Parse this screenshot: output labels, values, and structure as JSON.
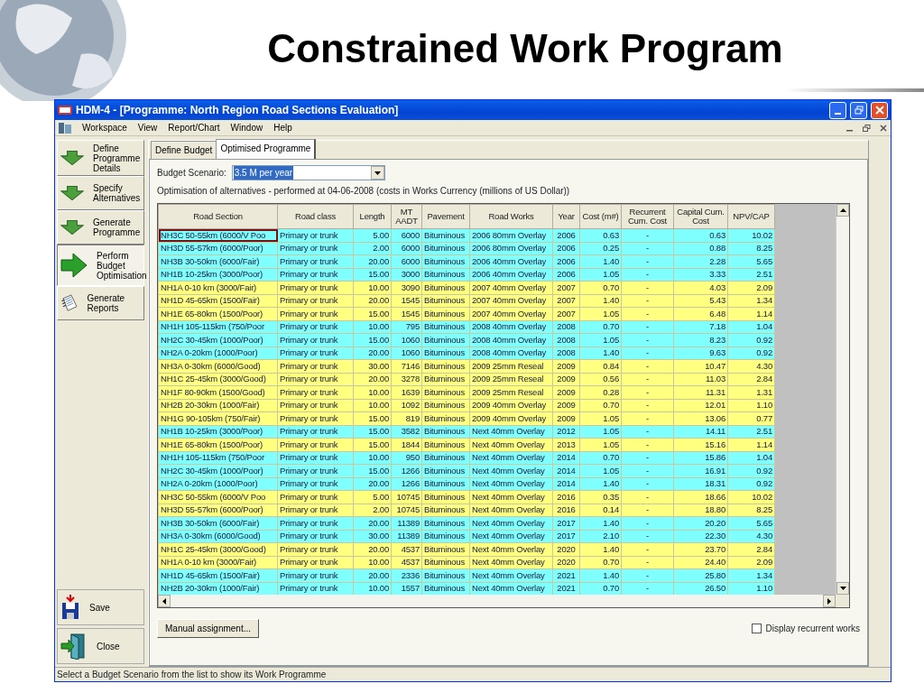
{
  "slide": {
    "title": "Constrained Work Program"
  },
  "window": {
    "title": "HDM-4 - [Programme: North Region Road Sections Evaluation]"
  },
  "menu": [
    "Workspace",
    "View",
    "Report/Chart",
    "Window",
    "Help"
  ],
  "steps": [
    {
      "label": "Define Programme Details",
      "kind": "down",
      "selected": false
    },
    {
      "label": "Specify Alternatives",
      "kind": "down",
      "selected": false
    },
    {
      "label": "Generate Programme",
      "kind": "down",
      "selected": false
    },
    {
      "label": "Perform Budget Optimisation",
      "kind": "right",
      "selected": true
    },
    {
      "label": "Generate Reports",
      "kind": "report",
      "selected": false
    }
  ],
  "actions": [
    {
      "label": "Save",
      "kind": "save"
    },
    {
      "label": "Close",
      "kind": "close"
    }
  ],
  "tabs": [
    {
      "label": "Define Budget",
      "selected": false
    },
    {
      "label": "Optimised Programme",
      "selected": true
    }
  ],
  "budget_scenario": {
    "label": "Budget Scenario:",
    "value": "3.5 M per year"
  },
  "caption": "Optimisation of alternatives - performed at 04-06-2008 (costs in Works Currency (millions of US Dollar))",
  "table": {
    "columns": [
      "Road Section",
      "Road class",
      "Length",
      "MT AADT",
      "Pavement",
      "Road Works",
      "Year",
      "Cost (m#)",
      "Recurrent Cum. Cost",
      "Capital Cum. Cost",
      "NPV/CAP"
    ],
    "rows": [
      {
        "cells": [
          "NH3C 50-55km (6000/V Poo",
          "Primary or trunk",
          "5.00",
          "6000",
          "Bituminous",
          "2006 80mm Overlay",
          "2006",
          "0.63",
          "-",
          "0.63",
          "10.02"
        ],
        "color": "#80ffff",
        "focused": true
      },
      {
        "cells": [
          "NH3D 55-57km (6000/Poor)",
          "Primary or trunk",
          "2.00",
          "6000",
          "Bituminous",
          "2006 80mm Overlay",
          "2006",
          "0.25",
          "-",
          "0.88",
          "8.25"
        ],
        "color": "#80ffff",
        "focused": false
      },
      {
        "cells": [
          "NH3B 30-50km (6000/Fair)",
          "Primary or trunk",
          "20.00",
          "6000",
          "Bituminous",
          "2006 40mm Overlay",
          "2006",
          "1.40",
          "-",
          "2.28",
          "5.65"
        ],
        "color": "#80ffff",
        "focused": false
      },
      {
        "cells": [
          "NH1B 10-25km (3000/Poor)",
          "Primary or trunk",
          "15.00",
          "3000",
          "Bituminous",
          "2006 40mm Overlay",
          "2006",
          "1.05",
          "-",
          "3.33",
          "2.51"
        ],
        "color": "#80ffff",
        "focused": false
      },
      {
        "cells": [
          "NH1A 0-10 km (3000/Fair)",
          "Primary or trunk",
          "10.00",
          "3090",
          "Bituminous",
          "2007 40mm Overlay",
          "2007",
          "0.70",
          "-",
          "4.03",
          "2.09"
        ],
        "color": "#ffff80",
        "focused": false
      },
      {
        "cells": [
          "NH1D 45-65km (1500/Fair)",
          "Primary or trunk",
          "20.00",
          "1545",
          "Bituminous",
          "2007 40mm Overlay",
          "2007",
          "1.40",
          "-",
          "5.43",
          "1.34"
        ],
        "color": "#ffff80",
        "focused": false
      },
      {
        "cells": [
          "NH1E 65-80km (1500/Poor)",
          "Primary or trunk",
          "15.00",
          "1545",
          "Bituminous",
          "2007 40mm Overlay",
          "2007",
          "1.05",
          "-",
          "6.48",
          "1.14"
        ],
        "color": "#ffff80",
        "focused": false
      },
      {
        "cells": [
          "NH1H 105-115km (750/Poor",
          "Primary or trunk",
          "10.00",
          "795",
          "Bituminous",
          "2008 40mm Overlay",
          "2008",
          "0.70",
          "-",
          "7.18",
          "1.04"
        ],
        "color": "#80ffff",
        "focused": false
      },
      {
        "cells": [
          "NH2C 30-45km (1000/Poor)",
          "Primary or trunk",
          "15.00",
          "1060",
          "Bituminous",
          "2008 40mm Overlay",
          "2008",
          "1.05",
          "-",
          "8.23",
          "0.92"
        ],
        "color": "#80ffff",
        "focused": false
      },
      {
        "cells": [
          "NH2A 0-20km (1000/Poor)",
          "Primary or trunk",
          "20.00",
          "1060",
          "Bituminous",
          "2008 40mm Overlay",
          "2008",
          "1.40",
          "-",
          "9.63",
          "0.92"
        ],
        "color": "#80ffff",
        "focused": false
      },
      {
        "cells": [
          "NH3A 0-30km (6000/Good)",
          "Primary or trunk",
          "30.00",
          "7146",
          "Bituminous",
          "2009 25mm Reseal",
          "2009",
          "0.84",
          "-",
          "10.47",
          "4.30"
        ],
        "color": "#ffff80",
        "focused": false
      },
      {
        "cells": [
          "NH1C 25-45km (3000/Good)",
          "Primary or trunk",
          "20.00",
          "3278",
          "Bituminous",
          "2009 25mm Reseal",
          "2009",
          "0.56",
          "-",
          "11.03",
          "2.84"
        ],
        "color": "#ffff80",
        "focused": false
      },
      {
        "cells": [
          "NH1F 80-90km (1500/Good)",
          "Primary or trunk",
          "10.00",
          "1639",
          "Bituminous",
          "2009 25mm Reseal",
          "2009",
          "0.28",
          "-",
          "11.31",
          "1.31"
        ],
        "color": "#ffff80",
        "focused": false
      },
      {
        "cells": [
          "NH2B 20-30km (1000/Fair)",
          "Primary or trunk",
          "10.00",
          "1092",
          "Bituminous",
          "2009 40mm Overlay",
          "2009",
          "0.70",
          "-",
          "12.01",
          "1.10"
        ],
        "color": "#ffff80",
        "focused": false
      },
      {
        "cells": [
          "NH1G 90-105km (750/Fair)",
          "Primary or trunk",
          "15.00",
          "819",
          "Bituminous",
          "2009 40mm Overlay",
          "2009",
          "1.05",
          "-",
          "13.06",
          "0.77"
        ],
        "color": "#ffff80",
        "focused": false
      },
      {
        "cells": [
          "NH1B 10-25km (3000/Poor)",
          "Primary or trunk",
          "15.00",
          "3582",
          "Bituminous",
          "Next 40mm Overlay",
          "2012",
          "1.05",
          "-",
          "14.11",
          "2.51"
        ],
        "color": "#80ffff",
        "focused": false
      },
      {
        "cells": [
          "NH1E 65-80km (1500/Poor)",
          "Primary or trunk",
          "15.00",
          "1844",
          "Bituminous",
          "Next 40mm Overlay",
          "2013",
          "1.05",
          "-",
          "15.16",
          "1.14"
        ],
        "color": "#ffff80",
        "focused": false
      },
      {
        "cells": [
          "NH1H 105-115km (750/Poor",
          "Primary or trunk",
          "10.00",
          "950",
          "Bituminous",
          "Next 40mm Overlay",
          "2014",
          "0.70",
          "-",
          "15.86",
          "1.04"
        ],
        "color": "#80ffff",
        "focused": false
      },
      {
        "cells": [
          "NH2C 30-45km (1000/Poor)",
          "Primary or trunk",
          "15.00",
          "1266",
          "Bituminous",
          "Next 40mm Overlay",
          "2014",
          "1.05",
          "-",
          "16.91",
          "0.92"
        ],
        "color": "#80ffff",
        "focused": false
      },
      {
        "cells": [
          "NH2A 0-20km (1000/Poor)",
          "Primary or trunk",
          "20.00",
          "1266",
          "Bituminous",
          "Next 40mm Overlay",
          "2014",
          "1.40",
          "-",
          "18.31",
          "0.92"
        ],
        "color": "#80ffff",
        "focused": false
      },
      {
        "cells": [
          "NH3C 50-55km (6000/V Poo",
          "Primary or trunk",
          "5.00",
          "10745",
          "Bituminous",
          "Next 40mm Overlay",
          "2016",
          "0.35",
          "-",
          "18.66",
          "10.02"
        ],
        "color": "#ffff80",
        "focused": false
      },
      {
        "cells": [
          "NH3D 55-57km (6000/Poor)",
          "Primary or trunk",
          "2.00",
          "10745",
          "Bituminous",
          "Next 40mm Overlay",
          "2016",
          "0.14",
          "-",
          "18.80",
          "8.25"
        ],
        "color": "#ffff80",
        "focused": false
      },
      {
        "cells": [
          "NH3B 30-50km (6000/Fair)",
          "Primary or trunk",
          "20.00",
          "11389",
          "Bituminous",
          "Next 40mm Overlay",
          "2017",
          "1.40",
          "-",
          "20.20",
          "5.65"
        ],
        "color": "#80ffff",
        "focused": false
      },
      {
        "cells": [
          "NH3A 0-30km (6000/Good)",
          "Primary or trunk",
          "30.00",
          "11389",
          "Bituminous",
          "Next 40mm Overlay",
          "2017",
          "2.10",
          "-",
          "22.30",
          "4.30"
        ],
        "color": "#80ffff",
        "focused": false
      },
      {
        "cells": [
          "NH1C 25-45km (3000/Good)",
          "Primary or trunk",
          "20.00",
          "4537",
          "Bituminous",
          "Next 40mm Overlay",
          "2020",
          "1.40",
          "-",
          "23.70",
          "2.84"
        ],
        "color": "#ffff80",
        "focused": false
      },
      {
        "cells": [
          "NH1A 0-10 km (3000/Fair)",
          "Primary or trunk",
          "10.00",
          "4537",
          "Bituminous",
          "Next 40mm Overlay",
          "2020",
          "0.70",
          "-",
          "24.40",
          "2.09"
        ],
        "color": "#ffff80",
        "focused": false
      },
      {
        "cells": [
          "NH1D 45-65km (1500/Fair)",
          "Primary or trunk",
          "20.00",
          "2336",
          "Bituminous",
          "Next 40mm Overlay",
          "2021",
          "1.40",
          "-",
          "25.80",
          "1.34"
        ],
        "color": "#80ffff",
        "focused": false
      },
      {
        "cells": [
          "NH2B 20-30km (1000/Fair)",
          "Primary or trunk",
          "10.00",
          "1557",
          "Bituminous",
          "Next 40mm Overlay",
          "2021",
          "0.70",
          "-",
          "26.50",
          "1.10"
        ],
        "color": "#80ffff",
        "focused": false
      }
    ]
  },
  "manual_button": "Manual assignment...",
  "display_recurrent": {
    "label": "Display recurrent works",
    "checked": false
  },
  "status_bar": "Select a Budget Scenario from the list to show its Work Programme"
}
